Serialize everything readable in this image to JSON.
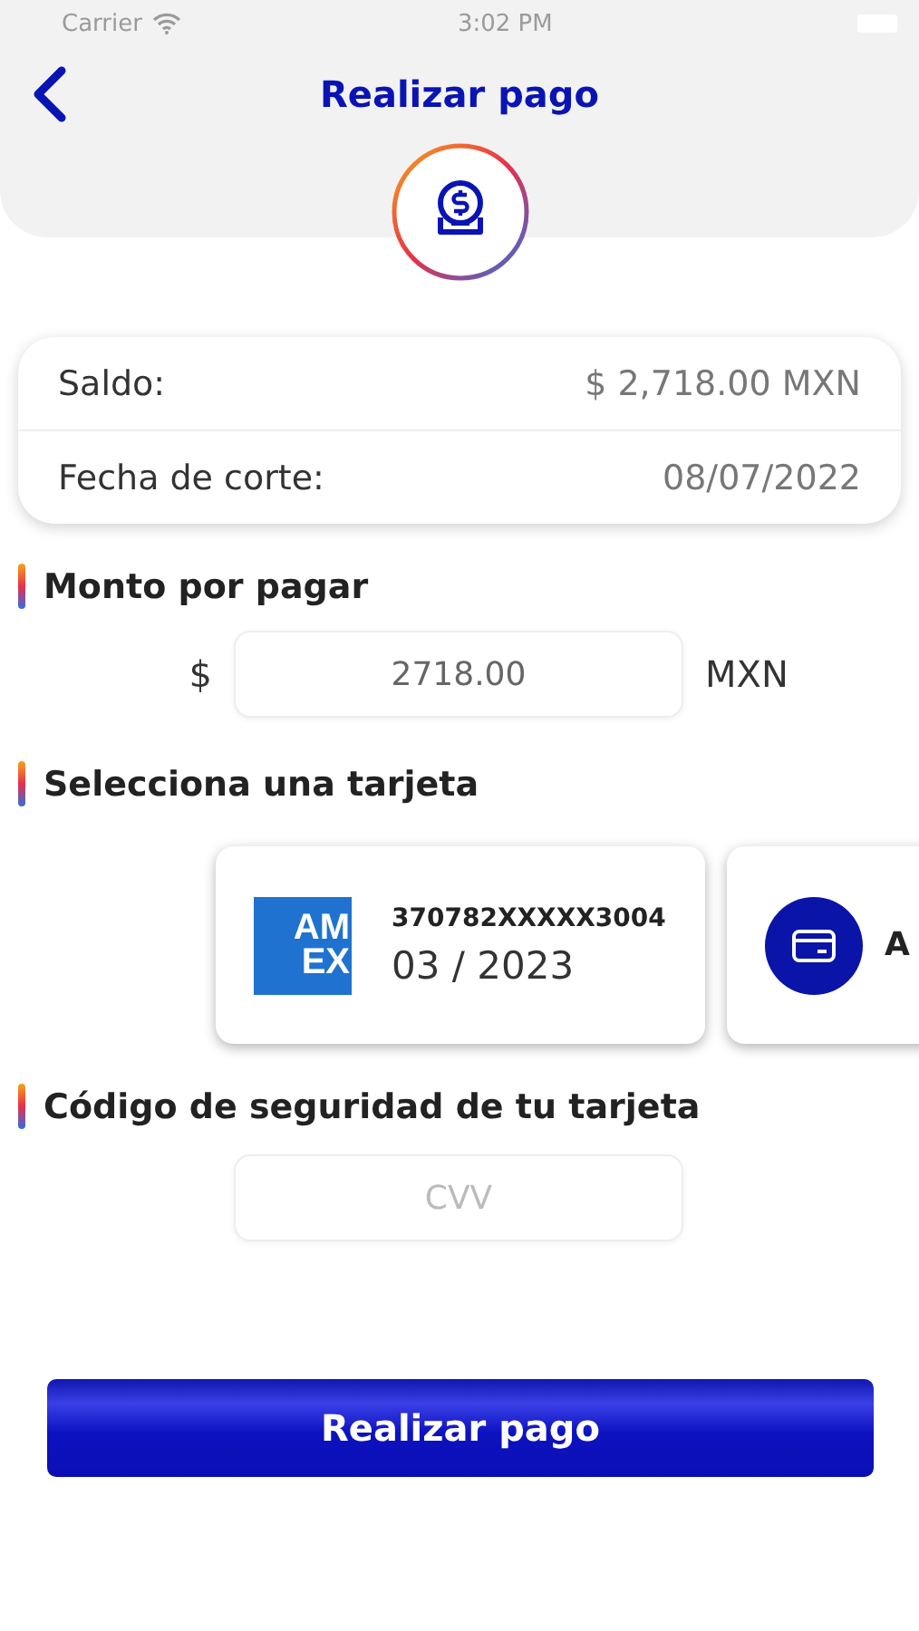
{
  "status_bar": {
    "carrier": "Carrier",
    "time": "3:02 PM"
  },
  "header": {
    "title": "Realizar pago"
  },
  "summary": [
    {
      "label": "Saldo:",
      "value": "$ 2,718.00 MXN"
    },
    {
      "label": "Fecha de corte:",
      "value": "08/07/2022"
    }
  ],
  "amount": {
    "title": "Monto por pagar",
    "prefix": "$",
    "value": "2718.00",
    "suffix": "MXN"
  },
  "cards_section": {
    "title": "Selecciona una tarjeta"
  },
  "cards": [
    {
      "kind": "amex",
      "logo_lines": [
        "AM",
        "EX"
      ],
      "number": "370782XXXXX3004",
      "expiry": "03 / 2023"
    },
    {
      "kind": "generic",
      "label": "A"
    }
  ],
  "security": {
    "title": "Código de seguridad de tu tarjeta",
    "placeholder": "CVV"
  },
  "submit_button": "Realizar pago"
}
